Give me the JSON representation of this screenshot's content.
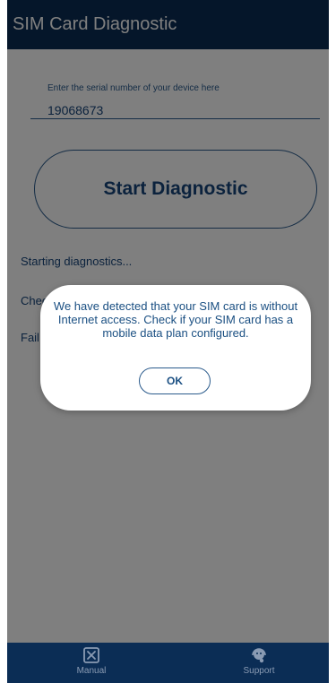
{
  "appbar": {
    "title": "SIM Card Diagnostic"
  },
  "serial_field": {
    "label": "Enter the serial number of your device here",
    "value": "19068673"
  },
  "start_button": {
    "label": "Start Diagnostic"
  },
  "log": {
    "line1": "Starting diagnostics...",
    "line2": "Chec",
    "line3": "Fail"
  },
  "dialog": {
    "message": "We have detected that your SIM card is without Internet access. Check if your SIM card has a mobile data plan configured.",
    "ok_label": "OK"
  },
  "bottom_nav": {
    "items": [
      {
        "label": "Manual",
        "icon": "manual-icon"
      },
      {
        "label": "Support",
        "icon": "support-headset-icon"
      }
    ]
  },
  "colors": {
    "primary": "#0b2d55",
    "text_blue": "#17457a",
    "accent_border": "#2b5b8c"
  }
}
